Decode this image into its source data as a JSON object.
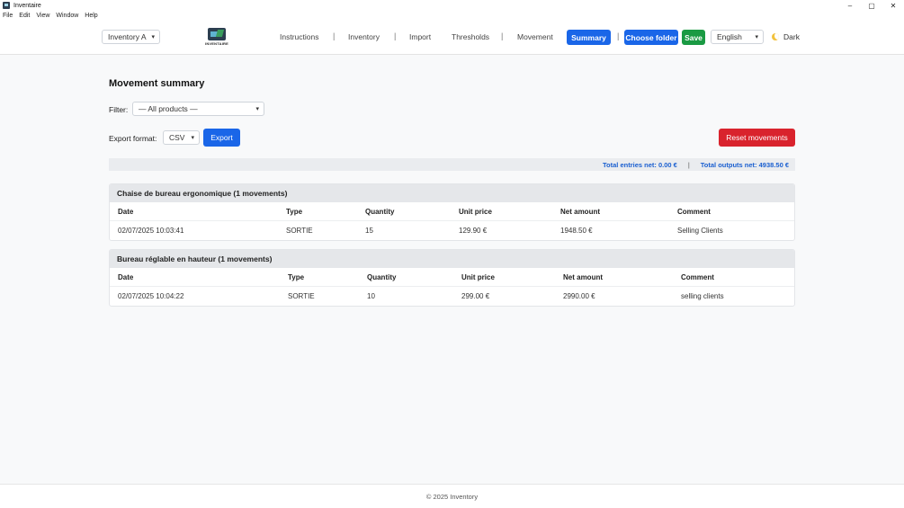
{
  "window": {
    "title": "Inventaire",
    "controls": [
      "–",
      "▢",
      "✕"
    ]
  },
  "menu": [
    "File",
    "Edit",
    "View",
    "Window",
    "Help"
  ],
  "navbar": {
    "inventory_select": "Inventory A",
    "logo_text": "INVENTAIRE",
    "links": [
      "Instructions",
      "Inventory",
      "Import",
      "Thresholds",
      "Movement"
    ],
    "separator": "|",
    "active_tab": "Summary",
    "choose_folder": "Choose folder",
    "save": "Save",
    "language": "English",
    "theme_toggle": "Dark"
  },
  "main": {
    "heading": "Movement summary",
    "filter_label": "Filter:",
    "filter_value": "— All products —",
    "export_label": "Export format:",
    "export_format": "CSV",
    "export_button": "Export",
    "reset_button": "Reset movements",
    "totals": {
      "entries": "Total entries net: 0.00 €",
      "separator": "|",
      "outputs": "Total outputs net: 4938.50 €"
    },
    "columns": [
      "Date",
      "Type",
      "Quantity",
      "Unit price",
      "Net amount",
      "Comment"
    ],
    "groups": [
      {
        "title": "Chaise de bureau ergonomique (1 movements)",
        "rows": [
          [
            "02/07/2025 10:03:41",
            "SORTIE",
            "15",
            "129.90 €",
            "1948.50 €",
            "Selling Clients"
          ]
        ]
      },
      {
        "title": "Bureau réglable en hauteur (1 movements)",
        "rows": [
          [
            "02/07/2025 10:04:22",
            "SORTIE",
            "10",
            "299.00 €",
            "2990.00 €",
            "selling clients"
          ]
        ]
      }
    ]
  },
  "footer": "© 2025 Inventory",
  "colors": {
    "primary": "#1a66e8",
    "success": "#1a9a43",
    "danger": "#d9232d",
    "totals_text": "#1a5fd0"
  }
}
